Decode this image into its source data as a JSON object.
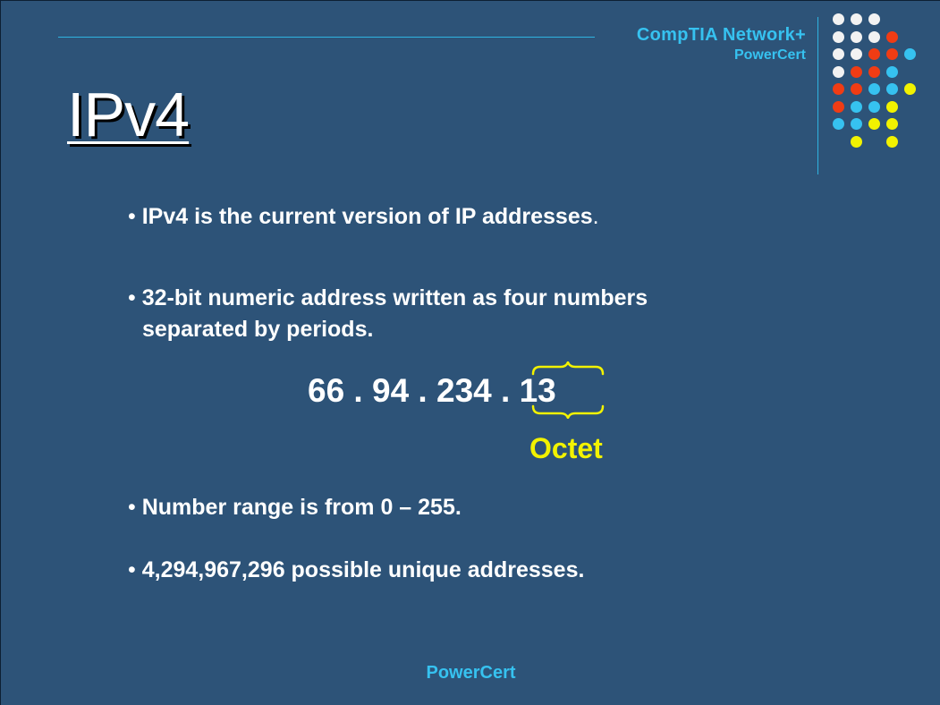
{
  "brand": {
    "line1": "CompTIA Network+",
    "line2": "PowerCert"
  },
  "title": "IPv4",
  "bullets": {
    "b1_text": "IPv4 is the current version of IP addresses",
    "b1_period": ".",
    "b2_line1": "32-bit numeric address written as four numbers",
    "b2_line2": "separated by periods.",
    "b3_text": "Number range is from 0 – 255.",
    "b4_text": "4,294,967,296 possible unique addresses."
  },
  "bullet_marker": "•",
  "ip_example": {
    "prefix": "66 . 94 . 234 .",
    "octet_value": "13",
    "octet_label": "Octet"
  },
  "footer": "PowerCert",
  "colors": {
    "background": "#2d5378",
    "accent_cyan": "#36c2f0",
    "accent_yellow": "#f2f200",
    "accent_red": "#f03c14",
    "text": "#ffffff"
  },
  "decor_dot_pattern": [
    [
      "white",
      "white",
      "white",
      null,
      null
    ],
    [
      "white",
      "white",
      "white",
      "red",
      null
    ],
    [
      "white",
      "white",
      "red",
      "red",
      "cyan"
    ],
    [
      "white",
      "red",
      "red",
      "cyan",
      null
    ],
    [
      "red",
      "red",
      "cyan",
      "cyan",
      "yellow"
    ],
    [
      "red",
      "cyan",
      "cyan",
      "yellow",
      null
    ],
    [
      "cyan",
      "cyan",
      "yellow",
      "yellow",
      null
    ],
    [
      null,
      "yellow",
      null,
      "yellow",
      null
    ]
  ]
}
